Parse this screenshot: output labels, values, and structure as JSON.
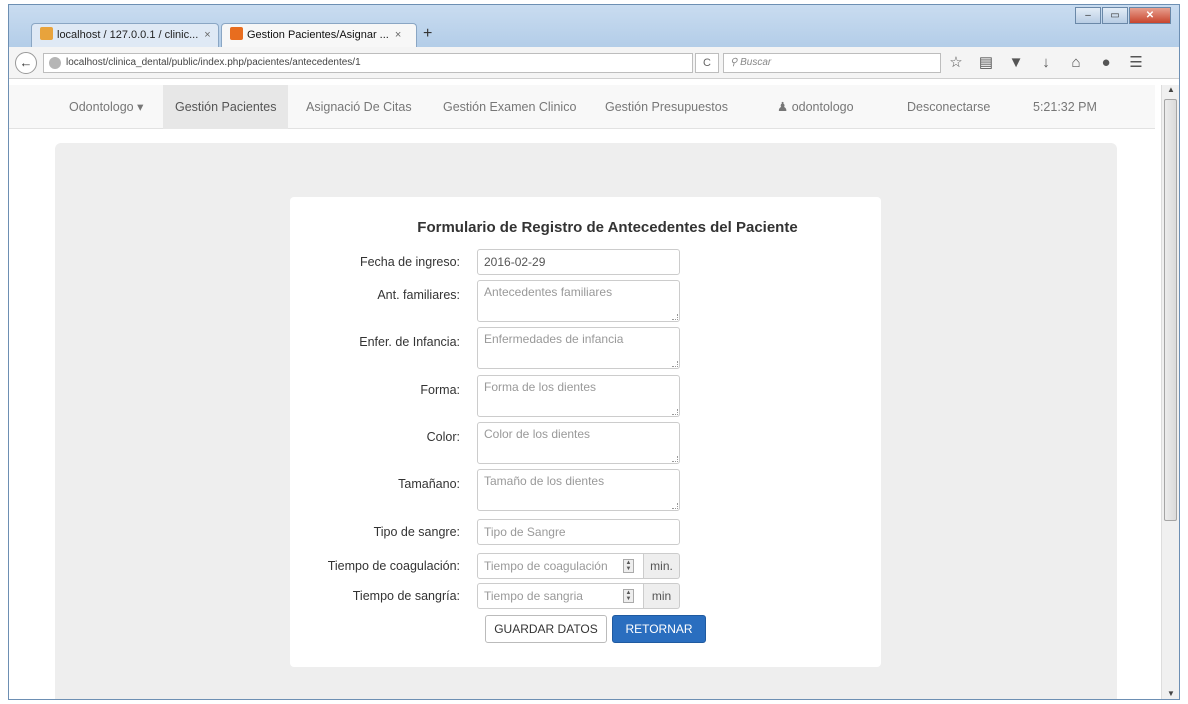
{
  "browser": {
    "tabs": [
      {
        "title": "localhost / 127.0.0.1 / clinic..."
      },
      {
        "title": "Gestion Pacientes/Asignar ..."
      }
    ],
    "new_tab": "+",
    "tab_close": "×",
    "url": "localhost/clinica_dental/public/index.php/pacientes/antecedentes/1",
    "reload": "C",
    "search_placeholder": "Buscar",
    "window_controls": {
      "minimize": "–",
      "maximize": "▭",
      "close": "✕"
    }
  },
  "nav": {
    "user_menu": "Odontologo ▾",
    "gestion_pacientes": "Gestión Pacientes",
    "asignacion_citas": "Asignació De Citas",
    "gestion_examen": "Gestión Examen Clinico",
    "gestion_presupuestos": "Gestión Presupuestos",
    "user_label": "odontologo",
    "logout": "Desconectarse",
    "time": "5:21:32 PM"
  },
  "form": {
    "title": "Formulario de Registro de Antecedentes del Paciente",
    "fields": {
      "fecha": {
        "label": "Fecha de ingreso:",
        "value": "2016-02-29"
      },
      "familiares": {
        "label": "Ant. familiares:",
        "placeholder": "Antecedentes familiares"
      },
      "infancia": {
        "label": "Enfer. de Infancia:",
        "placeholder": "Enfermedades de infancia"
      },
      "forma": {
        "label": "Forma:",
        "placeholder": "Forma de los dientes"
      },
      "color": {
        "label": "Color:",
        "placeholder": "Color de los dientes"
      },
      "tamano": {
        "label": "Tamañano:",
        "placeholder": "Tamaño de los dientes"
      },
      "sangre": {
        "label": "Tipo de sangre:",
        "placeholder": "Tipo de Sangre"
      },
      "coagulacion": {
        "label": "Tiempo de coagulación:",
        "placeholder": "Tiempo de coagulación",
        "unit": "min."
      },
      "sangria": {
        "label": "Tiempo de sangría:",
        "placeholder": "Tiempo de sangria",
        "unit": "min"
      }
    },
    "buttons": {
      "save": "GUARDAR DATOS",
      "back": "RETORNAR"
    }
  },
  "colors": {
    "primary": "#2a6ebf",
    "jumbotron": "#eeeeee",
    "navbar": "#f8f8f8"
  }
}
